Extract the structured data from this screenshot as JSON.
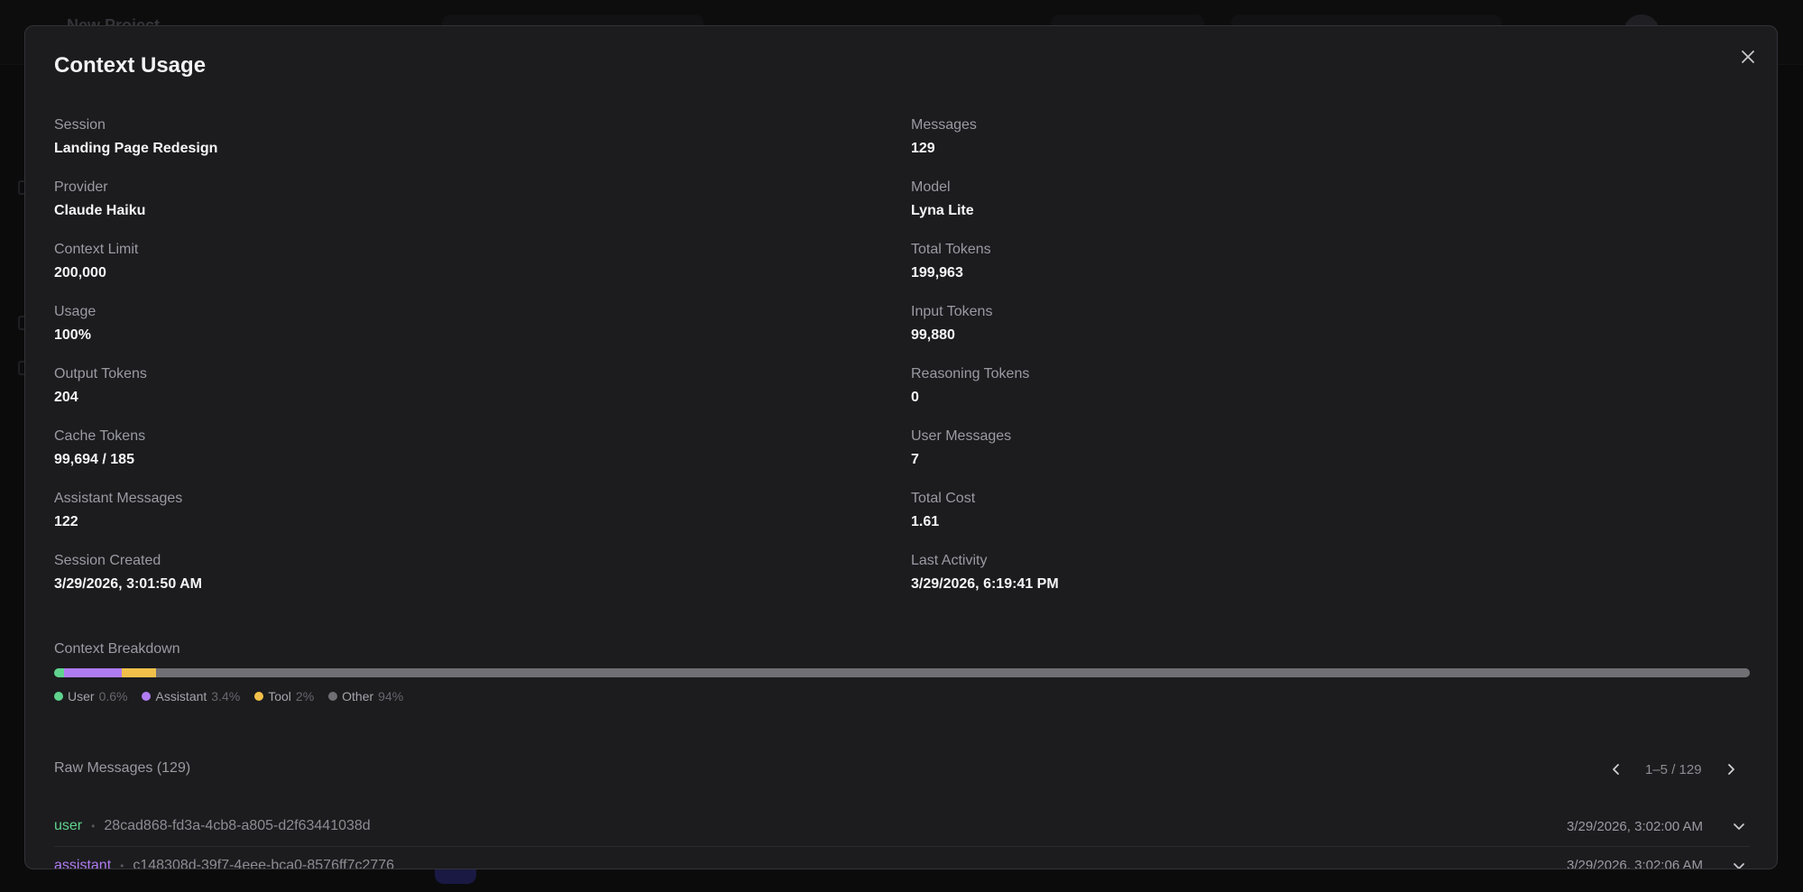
{
  "background": {
    "app_title": "New Project"
  },
  "modal": {
    "title": "Context Usage",
    "close_icon": "close-icon",
    "stats_left": [
      {
        "label": "Session",
        "value": "Landing Page Redesign"
      },
      {
        "label": "Provider",
        "value": "Claude Haiku"
      },
      {
        "label": "Context Limit",
        "value": "200,000"
      },
      {
        "label": "Usage",
        "value": "100%"
      },
      {
        "label": "Output Tokens",
        "value": "204"
      },
      {
        "label": "Cache Tokens",
        "value": "99,694 / 185"
      },
      {
        "label": "Assistant Messages",
        "value": "122"
      },
      {
        "label": "Session Created",
        "value": "3/29/2026, 3:01:50 AM"
      }
    ],
    "stats_right": [
      {
        "label": "Messages",
        "value": "129"
      },
      {
        "label": "Model",
        "value": "Lyna Lite"
      },
      {
        "label": "Total Tokens",
        "value": "199,963"
      },
      {
        "label": "Input Tokens",
        "value": "99,880"
      },
      {
        "label": "Reasoning Tokens",
        "value": "0"
      },
      {
        "label": "User Messages",
        "value": "7"
      },
      {
        "label": "Total Cost",
        "value": "1.61"
      },
      {
        "label": "Last Activity",
        "value": "3/29/2026, 6:19:41 PM"
      }
    ],
    "breakdown": {
      "label": "Context Breakdown",
      "segments": [
        {
          "name": "User",
          "pct_label": "0.6%",
          "fraction": 0.006,
          "color": "#5fd38d"
        },
        {
          "name": "Assistant",
          "pct_label": "3.4%",
          "fraction": 0.034,
          "color": "#b07cf2"
        },
        {
          "name": "Tool",
          "pct_label": "2%",
          "fraction": 0.02,
          "color": "#f2c04a"
        },
        {
          "name": "Other",
          "pct_label": "94%",
          "fraction": 0.94,
          "color": "#6f6f74"
        }
      ]
    },
    "raw": {
      "header": "Raw Messages (129)",
      "pager_text": "1–5 / 129",
      "prev_icon": "chevron-left-icon",
      "next_icon": "chevron-right-icon",
      "messages": [
        {
          "role": "user",
          "role_color": "#5fd38d",
          "id": "28cad868-fd3a-4cb8-a805-d2f63441038d",
          "time": "3/29/2026, 3:02:00 AM"
        },
        {
          "role": "assistant",
          "role_color": "#b07cf2",
          "id": "c148308d-39f7-4eee-bca0-8576ff7c2776",
          "time": "3/29/2026, 3:02:06 AM"
        }
      ]
    }
  }
}
